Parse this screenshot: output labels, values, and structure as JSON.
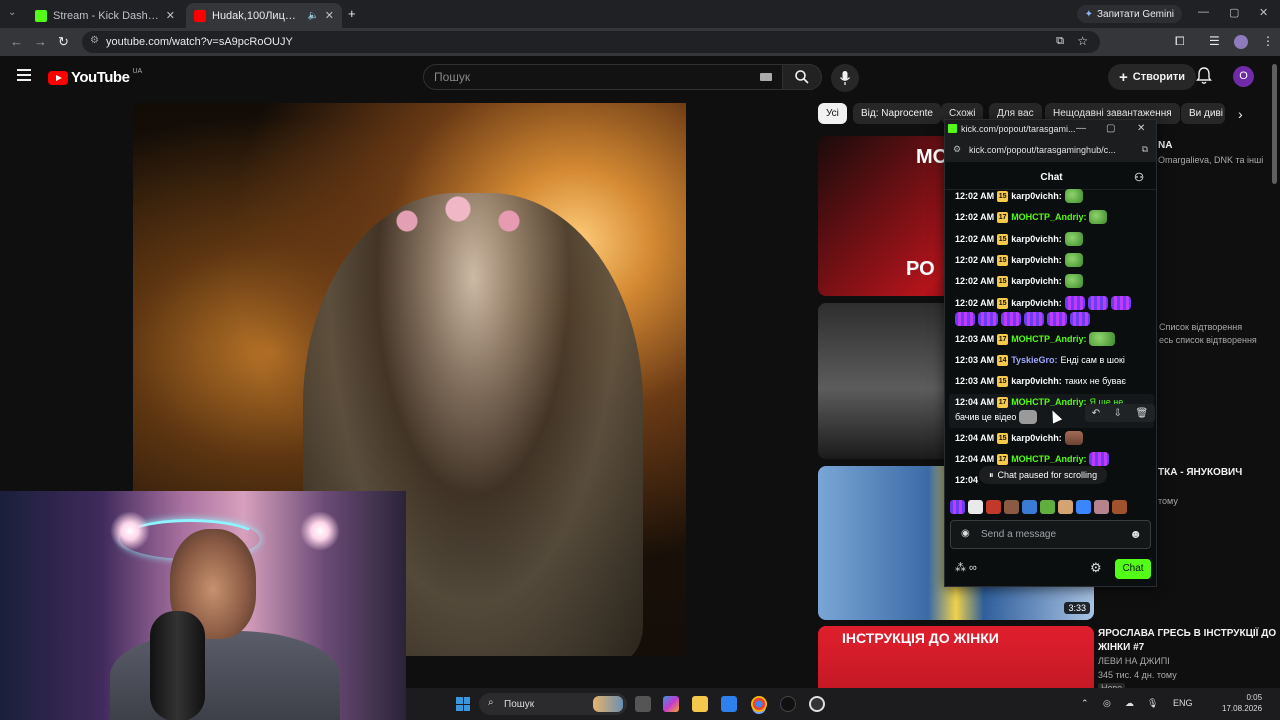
{
  "browser": {
    "tabs": [
      {
        "title": "Stream - Kick Dashboard",
        "active": false
      },
      {
        "title": "Hudak,100Лиця,Chico&Qa",
        "active": true
      }
    ],
    "gemini_label": "Запитати Gemini",
    "url": "youtube.com/watch?v=sA9pcRoOUJY"
  },
  "youtube": {
    "logo": "YouTube",
    "country": "UA",
    "search_placeholder": "Пошук",
    "create_label": "Створити",
    "avatar_letter": "О",
    "chips": [
      "Усі",
      "Від: Naprocente",
      "Схожі",
      "Для вас",
      "Нещодавні завантаження",
      "Ви диві"
    ]
  },
  "sidebar": {
    "item1": {
      "title_part": "NA",
      "meta": "Omargalieva, DNK та інші"
    },
    "item2": {
      "meta1": "Список відтворення",
      "meta2": "есь список відтворення"
    },
    "item3": {
      "title_part": "ТКА - ЯНУКОВИЧ",
      "meta": "тому",
      "duration": "3:33"
    },
    "item4": {
      "title_line1": "ЯРОСЛАВА ГРЕСЬ В ІНСТРУКЦІЇ ДО",
      "title_line2": "ЖІНКИ #7",
      "channel": "ЛЕВИ НА ДЖИПІ",
      "meta": "345 тис.  4 дн. тому",
      "badge": "Нове",
      "thumb_text": "ІНСТРУКЦІЯ ДО ЖІНКИ"
    },
    "thumb1_text": "МО",
    "thumb1_text2": "РО"
  },
  "kick": {
    "window_title": "kick.com/popout/tarasgami...",
    "url": "kick.com/popout/tarasgaminghub/c...",
    "header": "Chat",
    "messages": [
      {
        "time": "12:02 AM",
        "badge": "15",
        "user": "karp0vichh:",
        "text": ""
      },
      {
        "time": "12:02 AM",
        "badge": "17",
        "user": "МОНСТР_Andriy:",
        "text": ""
      },
      {
        "time": "12:02 AM",
        "badge": "15",
        "user": "karp0vichh:",
        "text": ""
      },
      {
        "time": "12:02 AM",
        "badge": "15",
        "user": "karp0vichh:",
        "text": ""
      },
      {
        "time": "12:02 AM",
        "badge": "15",
        "user": "karp0vichh:",
        "text": ""
      },
      {
        "time": "12:02 AM",
        "badge": "15",
        "user": "karp0vichh:",
        "text": ""
      },
      {
        "time": "12:03 AM",
        "badge": "17",
        "user": "МОНСТР_Andriy:",
        "text": ""
      },
      {
        "time": "12:03 AM",
        "badge": "14",
        "user": "TyskieGro:",
        "text": "Енді сам в шокі"
      },
      {
        "time": "12:03 AM",
        "badge": "15",
        "user": "karp0vichh:",
        "text": "таких не буває"
      },
      {
        "time": "12:04 AM",
        "badge": "17",
        "user": "МОНСТР_Andriy:",
        "text": "Я ще не"
      },
      {
        "time": "",
        "badge": "",
        "user": "",
        "text": "бачив це відео"
      },
      {
        "time": "12:04 AM",
        "badge": "15",
        "user": "karp0vichh:",
        "text": ""
      },
      {
        "time": "12:04 AM",
        "badge": "17",
        "user": "МОНСТР_Andriy:",
        "text": ""
      },
      {
        "time": "12:04",
        "badge": "",
        "user": "",
        "text": ""
      }
    ],
    "paused_label": "Chat paused for scrolling",
    "input_placeholder": "Send a message",
    "chat_button": "Chat",
    "colors": {
      "green": "#53fc18",
      "user_monstr": "#53fc18",
      "user_karp": "#ffffff",
      "user_tyskie": "#9fa8ff"
    }
  },
  "taskbar": {
    "search": "Пошук",
    "lang": "ENG",
    "time": "0:05",
    "date": "17.08.2026"
  }
}
